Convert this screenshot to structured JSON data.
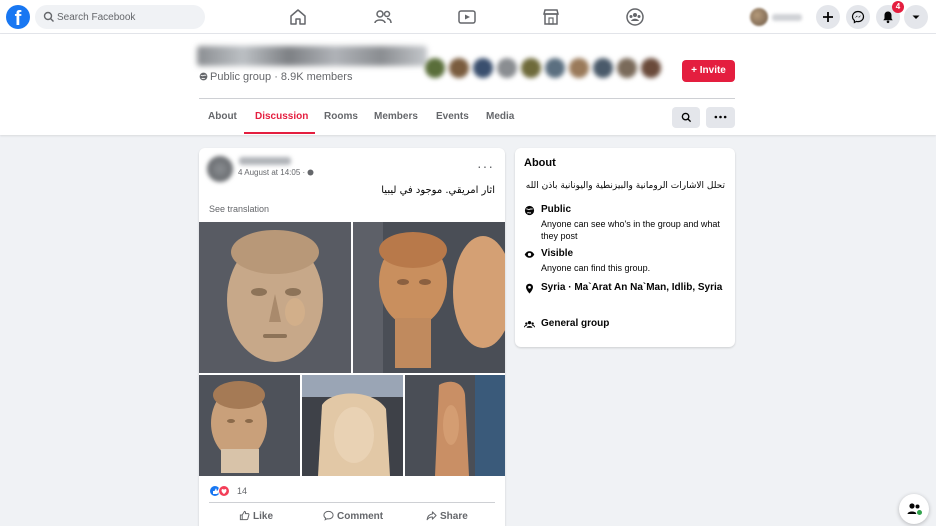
{
  "topbar": {
    "logo_letter": "f",
    "search_placeholder": "Search Facebook",
    "notifications_count": "4"
  },
  "group": {
    "meta": "Public group · 8.9K members",
    "invite_label": "+ Invite",
    "tabs": [
      "About",
      "Discussion",
      "Rooms",
      "Members",
      "Events",
      "Media"
    ],
    "active_tab": "Discussion"
  },
  "post": {
    "date": "4 August at 14:05 · ",
    "text": "اثار امريقي. موجود في ليبيا",
    "see_translation": "See translation",
    "reaction_count": "14",
    "actions": [
      "Like",
      "Comment",
      "Share"
    ],
    "more": "···"
  },
  "about": {
    "title": "About",
    "description": "تحلل الاشارات الرومانية والبيزنطية واليونانية باذن الله",
    "rows": [
      {
        "head": "Public",
        "sub": "Anyone can see who's in the group and what they post",
        "icon": "globe-icon"
      },
      {
        "head": "Visible",
        "sub": "Anyone can find this group.",
        "icon": "eye-icon"
      },
      {
        "head": "Syria · Ma`Arat An Na`Man, Idlib, Syria",
        "sub": "",
        "icon": "location-pin-icon"
      },
      {
        "head": "General group",
        "sub": "",
        "icon": "group-icon"
      }
    ]
  },
  "colors": {
    "brand": "#1877f2",
    "accent": "#e41e3f",
    "page_bg": "#f0f2f5"
  }
}
